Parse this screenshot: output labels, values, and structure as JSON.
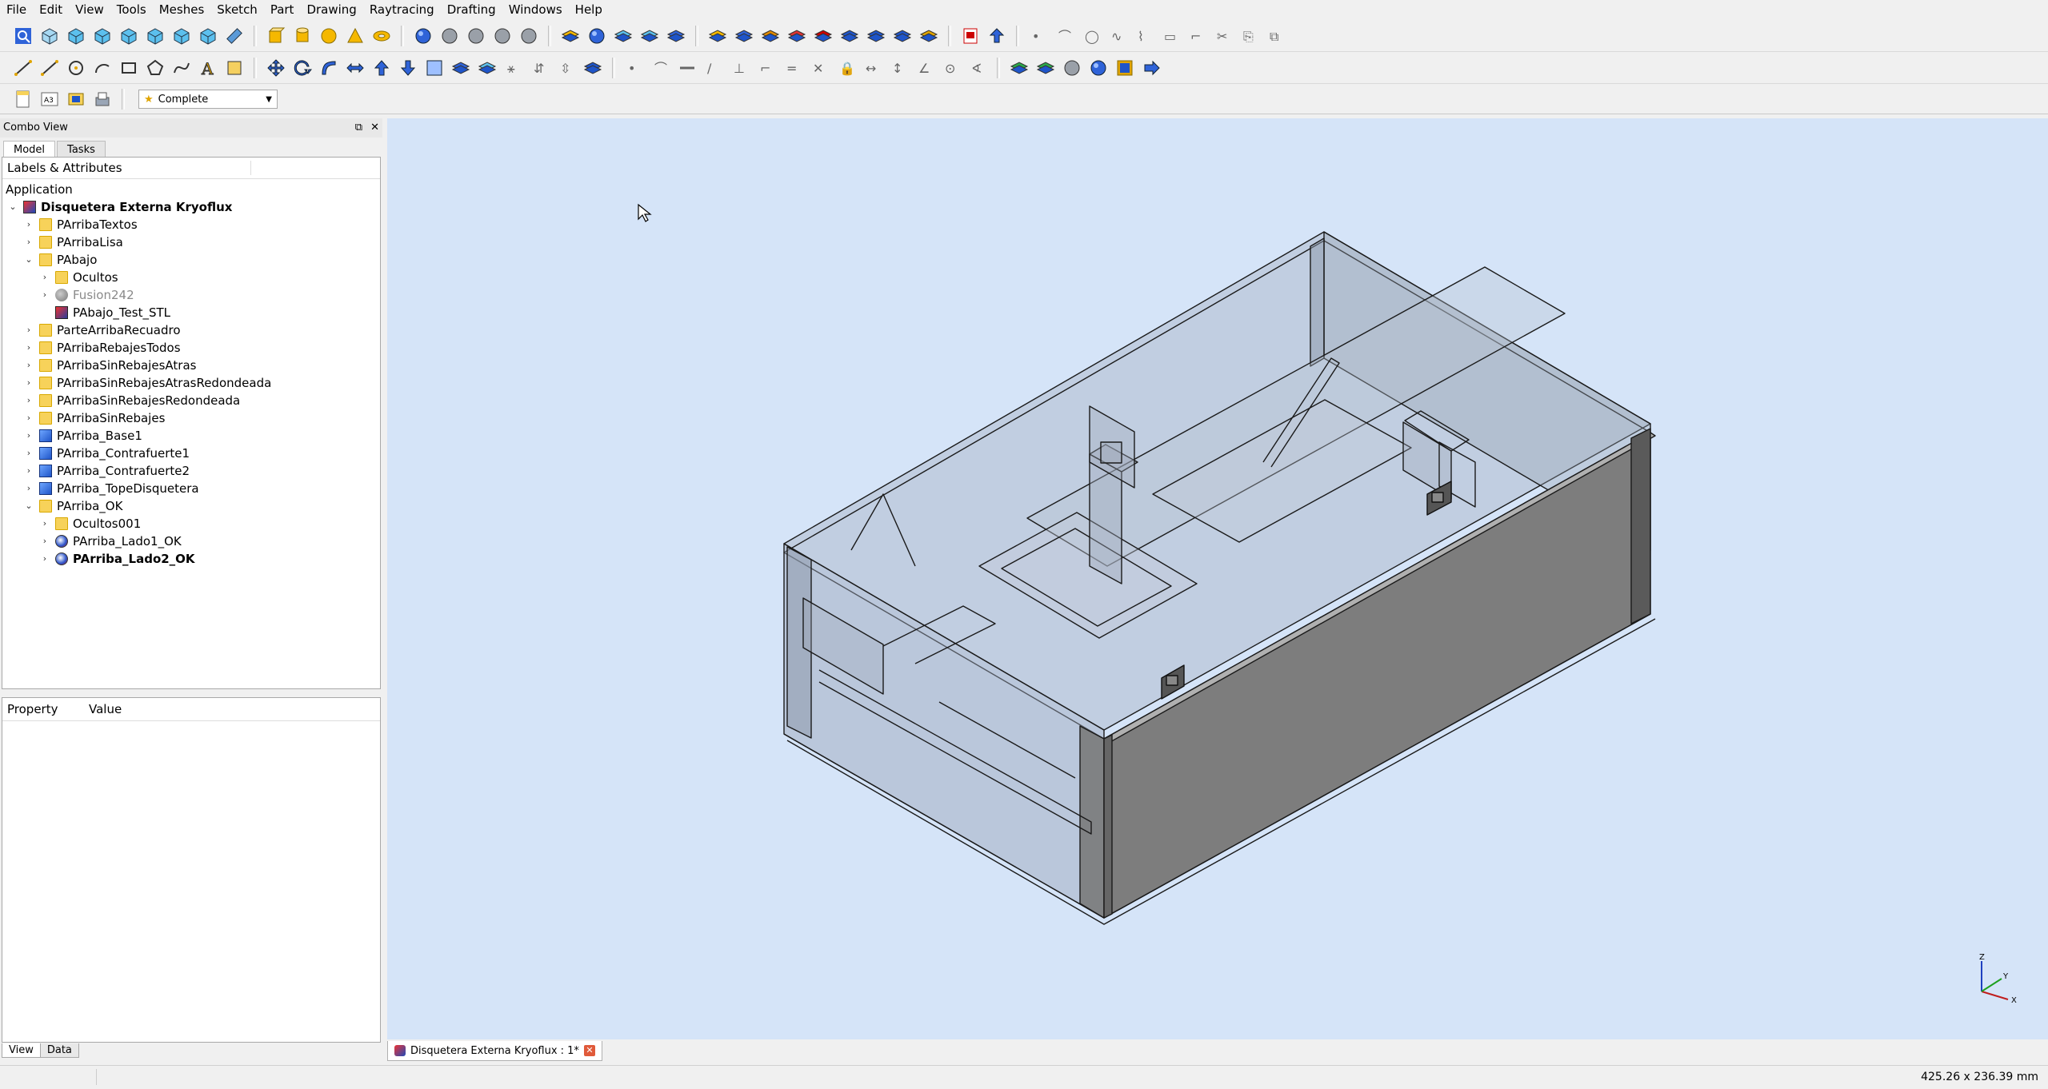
{
  "menu": [
    "File",
    "Edit",
    "View",
    "Tools",
    "Meshes",
    "Sketch",
    "Part",
    "Drawing",
    "Raytracing",
    "Drafting",
    "Windows",
    "Help"
  ],
  "workbench_selector": {
    "value": "Complete"
  },
  "combo_view": {
    "title": "Combo View",
    "tabs": [
      "Model",
      "Tasks"
    ],
    "tree_header": "Labels & Attributes",
    "tree_section": "Application",
    "tree_items": [
      {
        "label": "Disquetera Externa Kryoflux",
        "level": 0,
        "icon": "document-icon",
        "expander": "open",
        "style": "bold"
      },
      {
        "label": "PArribaTextos",
        "level": 1,
        "icon": "folder-icon",
        "expander": "closed"
      },
      {
        "label": "PArribaLisa",
        "level": 1,
        "icon": "folder-icon",
        "expander": "closed"
      },
      {
        "label": "PAbajo",
        "level": 1,
        "icon": "folder-icon",
        "expander": "open"
      },
      {
        "label": "Ocultos",
        "level": 2,
        "icon": "folder-icon",
        "expander": "closed"
      },
      {
        "label": "Fusion242",
        "level": 2,
        "icon": "fusion-icon",
        "expander": "closed",
        "style": "grey"
      },
      {
        "label": "PAbajo_Test_STL",
        "level": 2,
        "icon": "mesh-icon",
        "expander": "none"
      },
      {
        "label": "ParteArribaRecuadro",
        "level": 1,
        "icon": "folder-icon",
        "expander": "closed"
      },
      {
        "label": "PArribaRebajesTodos",
        "level": 1,
        "icon": "folder-icon",
        "expander": "closed"
      },
      {
        "label": "PArribaSinRebajesAtras",
        "level": 1,
        "icon": "folder-icon",
        "expander": "closed"
      },
      {
        "label": "PArribaSinRebajesAtrasRedondeada",
        "level": 1,
        "icon": "folder-icon",
        "expander": "closed"
      },
      {
        "label": "PArribaSinRebajesRedondeada",
        "level": 1,
        "icon": "folder-icon",
        "expander": "closed"
      },
      {
        "label": "PArribaSinRebajes",
        "level": 1,
        "icon": "folder-icon",
        "expander": "closed"
      },
      {
        "label": "PArriba_Base1",
        "level": 1,
        "icon": "solid-icon",
        "expander": "closed"
      },
      {
        "label": "PArriba_Contrafuerte1",
        "level": 1,
        "icon": "solid-icon",
        "expander": "closed"
      },
      {
        "label": "PArriba_Contrafuerte2",
        "level": 1,
        "icon": "solid-icon",
        "expander": "closed"
      },
      {
        "label": "PArriba_TopeDisquetera",
        "level": 1,
        "icon": "solid-icon",
        "expander": "closed"
      },
      {
        "label": "PArriba_OK",
        "level": 1,
        "icon": "folder-icon",
        "expander": "open"
      },
      {
        "label": "Ocultos001",
        "level": 2,
        "icon": "folder-icon",
        "expander": "closed"
      },
      {
        "label": "PArriba_Lado1_OK",
        "level": 2,
        "icon": "boolean-icon",
        "expander": "closed"
      },
      {
        "label": "PArriba_Lado2_OK",
        "level": 2,
        "icon": "boolean-icon",
        "expander": "closed",
        "style": "bold"
      }
    ],
    "property_columns": [
      "Property",
      "Value"
    ],
    "bottom_tabs": [
      "View",
      "Data"
    ]
  },
  "document_tab": {
    "label": "Disquetera Externa Kryoflux : 1*"
  },
  "status_bar": {
    "dimensions": "425.26 x 236.39 mm"
  },
  "axis_labels": {
    "x": "X",
    "y": "Y",
    "z": "Z"
  },
  "colors": {
    "viewport_bg": "#d5e4f8",
    "accent": "#2f63d8"
  }
}
